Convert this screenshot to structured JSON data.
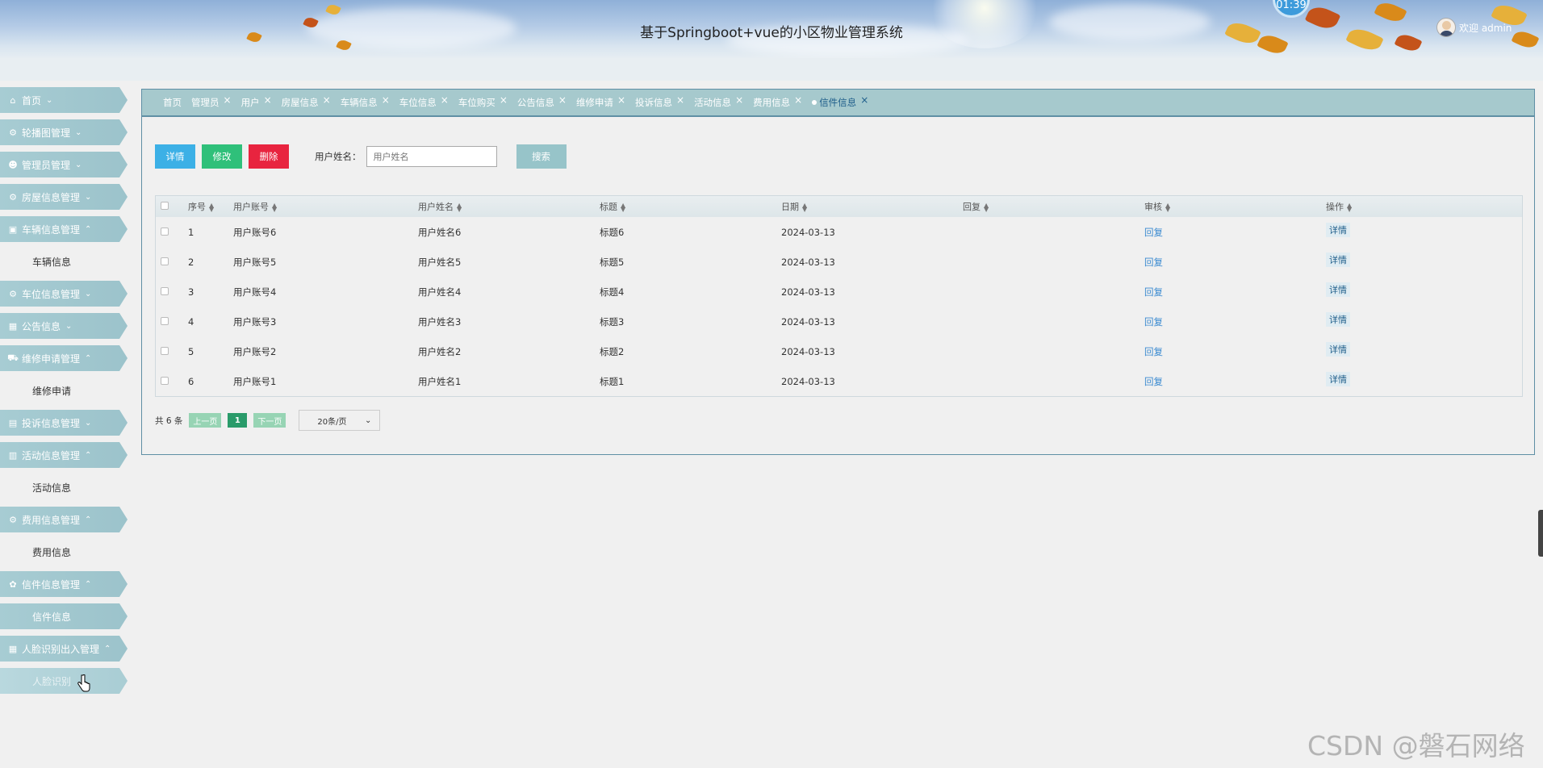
{
  "header": {
    "title": "基于Springboot+vue的小区物业管理系统",
    "clock": "01:39",
    "welcome": "欢迎 admin"
  },
  "sidebar": {
    "items": [
      {
        "label": "首页",
        "icon": "home-icon",
        "glyph": "⌂",
        "chevron": "⌄"
      },
      {
        "label": "轮播图管理",
        "icon": "gear-icon",
        "glyph": "⚙",
        "chevron": "⌄"
      },
      {
        "label": "管理员管理",
        "icon": "users-icon",
        "glyph": "☻",
        "chevron": "⌄"
      },
      {
        "label": "房屋信息管理",
        "icon": "settings-icon",
        "glyph": "⚙",
        "chevron": "⌄"
      },
      {
        "label": "车辆信息管理",
        "icon": "car-icon",
        "glyph": "▣",
        "chevron": "⌃",
        "sub": "车辆信息"
      },
      {
        "label": "车位信息管理",
        "icon": "parking-icon",
        "glyph": "⚙",
        "chevron": "⌄"
      },
      {
        "label": "公告信息",
        "icon": "grid-icon",
        "glyph": "▦",
        "chevron": "⌄"
      },
      {
        "label": "维修申请管理",
        "icon": "wrench-icon",
        "glyph": "⛟",
        "chevron": "⌃",
        "sub": "维修申请"
      },
      {
        "label": "投诉信息管理",
        "icon": "complaint-icon",
        "glyph": "▤",
        "chevron": "⌄"
      },
      {
        "label": "活动信息管理",
        "icon": "activity-icon",
        "glyph": "▥",
        "chevron": "⌃",
        "sub": "活动信息"
      },
      {
        "label": "费用信息管理",
        "icon": "fee-icon",
        "glyph": "⚙",
        "chevron": "⌃",
        "sub": "费用信息"
      },
      {
        "label": "信件信息管理",
        "icon": "mail-icon",
        "glyph": "✿",
        "chevron": "⌃",
        "sub": "信件信息"
      },
      {
        "label": "人脸识别出入管理",
        "icon": "face-icon",
        "glyph": "▦",
        "chevron": "⌃",
        "sub": "人脸识别"
      }
    ]
  },
  "tabs": [
    "首页",
    "管理员",
    "用户",
    "房屋信息",
    "车辆信息",
    "车位信息",
    "车位购买",
    "公告信息",
    "维修申请",
    "投诉信息",
    "活动信息",
    "费用信息",
    "信件信息"
  ],
  "toolbar": {
    "detail": "详情",
    "edit": "修改",
    "delete": "删除",
    "search_label": "用户姓名：",
    "search_placeholder": "用户姓名",
    "search": "搜索"
  },
  "table": {
    "headers": [
      "序号",
      "用户账号",
      "用户姓名",
      "标题",
      "日期",
      "回复",
      "审核",
      "操作"
    ],
    "rows": [
      {
        "no": "1",
        "account": "用户账号6",
        "name": "用户姓名6",
        "title": "标题6",
        "date": "2024-03-13",
        "reply": "",
        "audit": "回复",
        "action": "详情"
      },
      {
        "no": "2",
        "account": "用户账号5",
        "name": "用户姓名5",
        "title": "标题5",
        "date": "2024-03-13",
        "reply": "",
        "audit": "回复",
        "action": "详情"
      },
      {
        "no": "3",
        "account": "用户账号4",
        "name": "用户姓名4",
        "title": "标题4",
        "date": "2024-03-13",
        "reply": "",
        "audit": "回复",
        "action": "详情"
      },
      {
        "no": "4",
        "account": "用户账号3",
        "name": "用户姓名3",
        "title": "标题3",
        "date": "2024-03-13",
        "reply": "",
        "audit": "回复",
        "action": "详情"
      },
      {
        "no": "5",
        "account": "用户账号2",
        "name": "用户姓名2",
        "title": "标题2",
        "date": "2024-03-13",
        "reply": "",
        "audit": "回复",
        "action": "详情"
      },
      {
        "no": "6",
        "account": "用户账号1",
        "name": "用户姓名1",
        "title": "标题1",
        "date": "2024-03-13",
        "reply": "",
        "audit": "回复",
        "action": "详情"
      }
    ]
  },
  "pager": {
    "total": "共 6 条",
    "prev": "上一页",
    "current": "1",
    "next": "下一页",
    "page_size": "20条/页"
  },
  "watermark": "CSDN @磐石网络",
  "colors": {
    "detail": "#3cb0e6",
    "edit": "#2fc07a",
    "delete": "#e8243f",
    "search": "#97c4c9",
    "sidebar": "#a7ccd3",
    "link": "#3a8ad0"
  }
}
